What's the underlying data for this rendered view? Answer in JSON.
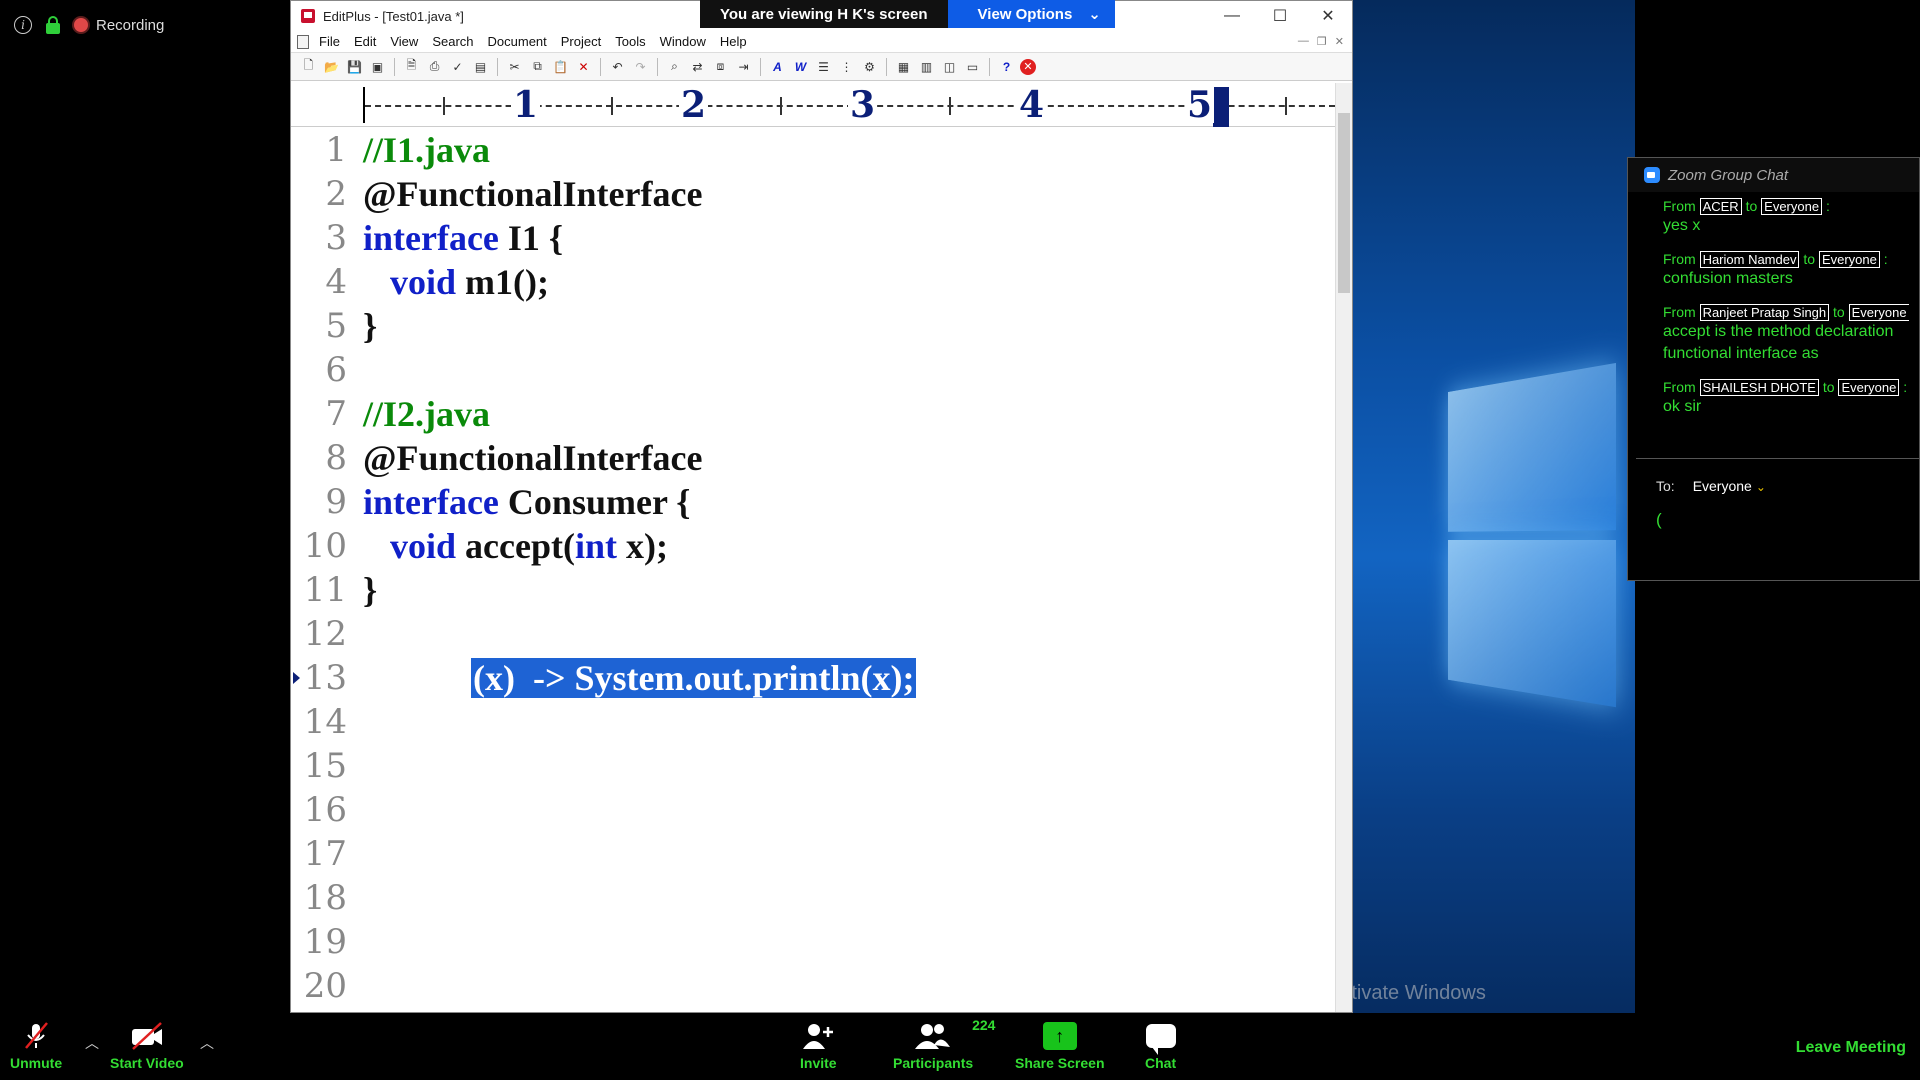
{
  "status_bar": {
    "recording_label": "Recording"
  },
  "share_banner": {
    "viewing_text": "You are viewing H K's screen",
    "options_label": "View Options"
  },
  "editplus": {
    "title": "EditPlus - [Test01.java *]",
    "menu": [
      "File",
      "Edit",
      "View",
      "Search",
      "Document",
      "Project",
      "Tools",
      "Window",
      "Help"
    ],
    "ruler_numbers": [
      "1",
      "2",
      "3",
      "4",
      "5"
    ],
    "lines": [
      {
        "no": "1",
        "parts": [
          {
            "t": "//I1.java",
            "c": "comment"
          }
        ]
      },
      {
        "no": "2",
        "parts": [
          {
            "t": "@FunctionalInterface",
            "c": "plain"
          }
        ]
      },
      {
        "no": "3",
        "parts": [
          {
            "t": "interface",
            "c": "kw"
          },
          {
            "t": " I1 {",
            "c": "plain"
          }
        ]
      },
      {
        "no": "4",
        "parts": [
          {
            "t": "   void",
            "c": "kw"
          },
          {
            "t": " m1();",
            "c": "plain"
          }
        ]
      },
      {
        "no": "5",
        "parts": [
          {
            "t": "}",
            "c": "plain"
          }
        ]
      },
      {
        "no": "6",
        "parts": []
      },
      {
        "no": "7",
        "parts": [
          {
            "t": "//I2.java",
            "c": "comment"
          }
        ]
      },
      {
        "no": "8",
        "parts": [
          {
            "t": "@FunctionalInterface",
            "c": "plain"
          }
        ]
      },
      {
        "no": "9",
        "parts": [
          {
            "t": "interface",
            "c": "kw"
          },
          {
            "t": " Consumer {",
            "c": "plain"
          }
        ]
      },
      {
        "no": "10",
        "parts": [
          {
            "t": "   void",
            "c": "kw"
          },
          {
            "t": " accept(",
            "c": "plain"
          },
          {
            "t": "int",
            "c": "kw"
          },
          {
            "t": " x);",
            "c": "plain"
          }
        ]
      },
      {
        "no": "11",
        "parts": [
          {
            "t": "}",
            "c": "plain"
          }
        ]
      },
      {
        "no": "12",
        "parts": []
      },
      {
        "no": "13",
        "parts": [
          {
            "t": "            ",
            "c": "plain"
          },
          {
            "t": "(x)  -> System.out.println(x);",
            "c": "sel"
          }
        ],
        "marker": true
      },
      {
        "no": "14",
        "parts": []
      },
      {
        "no": "15",
        "parts": []
      },
      {
        "no": "16",
        "parts": []
      },
      {
        "no": "17",
        "parts": []
      },
      {
        "no": "18",
        "parts": []
      },
      {
        "no": "19",
        "parts": []
      },
      {
        "no": "20",
        "parts": []
      }
    ]
  },
  "watermark": "Activate Windows",
  "chat": {
    "title": "Zoom Group Chat",
    "messages": [
      {
        "from_word": "From",
        "sender": "ACER",
        "to_word": "to",
        "recipient": "Everyone",
        "text": "yes x"
      },
      {
        "from_word": "From",
        "sender": "Hariom Namdev",
        "to_word": "to",
        "recipient": "Everyone",
        "text": "confusion masters"
      },
      {
        "from_word": "From",
        "sender": "Ranjeet Pratap Singh",
        "to_word": "to",
        "recipient": "Everyone",
        "text": "accept is the method declaration functional interface as"
      },
      {
        "from_word": "From",
        "sender": "SHAILESH DHOTE",
        "to_word": "to",
        "recipient": "Everyone",
        "text": "ok sir"
      }
    ],
    "to_label": "To:",
    "to_value": "Everyone",
    "input_text": "("
  },
  "bottom_bar": {
    "unmute": "Unmute",
    "start_video": "Start Video",
    "invite": "Invite",
    "participants": "Participants",
    "participants_count": "224",
    "share_screen": "Share Screen",
    "chat": "Chat",
    "leave": "Leave Meeting"
  }
}
